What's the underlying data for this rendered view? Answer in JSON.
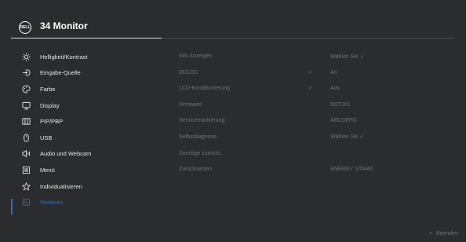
{
  "header": {
    "logo_text": "DELL",
    "title": "34 Monitor"
  },
  "menu": {
    "items": [
      {
        "label": "Helligkeit/Kontrast",
        "icon": "brightness-icon"
      },
      {
        "label": "Eingabe-Quelle",
        "icon": "input-source-icon"
      },
      {
        "label": "Farbe",
        "icon": "color-palette-icon"
      },
      {
        "label": "Display",
        "icon": "display-icon"
      },
      {
        "label": "PIP/PBP",
        "icon": "pip-pbp-icon"
      },
      {
        "label": "USB",
        "icon": "usb-mouse-icon"
      },
      {
        "label": "Audio und Webcam",
        "icon": "audio-webcam-icon"
      },
      {
        "label": "Menü",
        "icon": "menu-icon"
      },
      {
        "label": "Individualisieren",
        "icon": "star-icon"
      },
      {
        "label": "Weiteres",
        "icon": "others-icon",
        "active": true
      }
    ]
  },
  "settings": {
    "rows": [
      {
        "label": "Info Anzeigen",
        "chevron": "",
        "value": "Wählen Sie ✓"
      },
      {
        "label": "DDC/CI",
        "chevron": ">",
        "value": "An"
      },
      {
        "label": "LCD-Konditionierung",
        "chevron": ">",
        "value": "Aus"
      },
      {
        "label": "Firmware",
        "chevron": "",
        "value": "M2T101"
      },
      {
        "label": "Servicemarkierung",
        "chevron": "",
        "value": "ABCDEFG"
      },
      {
        "label": "Selbstdiagnose",
        "chevron": "",
        "value": "Wählen Sie √"
      },
      {
        "label": "Sonstige zurücks.",
        "chevron": "",
        "value": ""
      },
      {
        "label": "Zurücksetzen",
        "chevron": "",
        "value": "ENERGY STAR®"
      }
    ]
  },
  "footer": {
    "exit_arrow": "<",
    "exit_label": "Beenden"
  },
  "colors": {
    "background": "#2b2c2e",
    "accent": "#2e6ec8",
    "muted": "#707276",
    "text": "#e6e6e6"
  }
}
